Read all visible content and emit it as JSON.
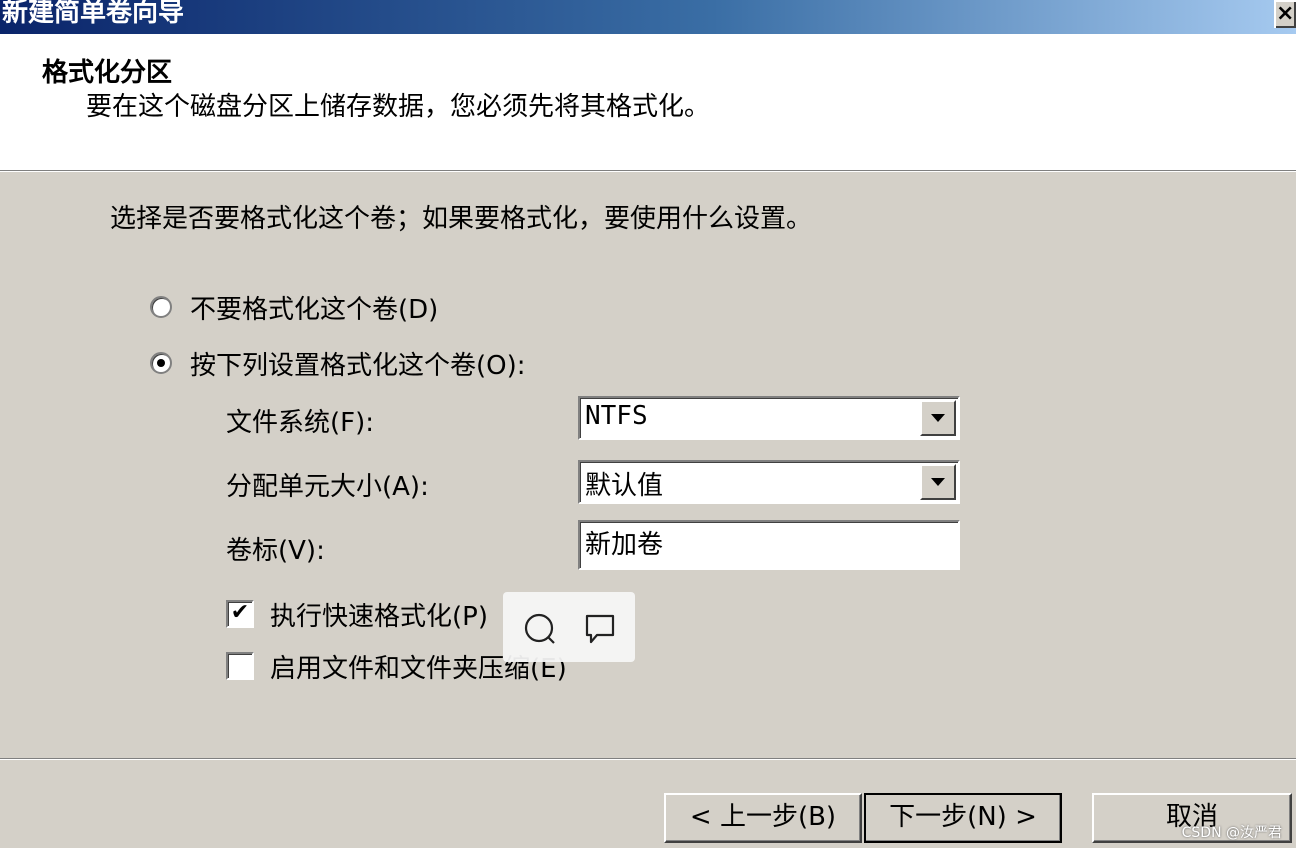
{
  "window": {
    "title": "新建简单卷向导",
    "close_glyph": "×"
  },
  "header": {
    "title": "格式化分区",
    "description": "要在这个磁盘分区上储存数据，您必须先将其格式化。"
  },
  "body": {
    "instruction": "选择是否要格式化这个卷；如果要格式化，要使用什么设置。",
    "radio_no_format": {
      "label": "不要格式化这个卷(D)",
      "checked": false
    },
    "radio_format": {
      "label": "按下列设置格式化这个卷(O):",
      "checked": true
    },
    "filesystem": {
      "label": "文件系统(F):",
      "value": "NTFS"
    },
    "alloc_unit": {
      "label": "分配单元大小(A):",
      "value": "默认值"
    },
    "volume_label": {
      "label": "卷标(V):",
      "value": "新加卷"
    },
    "quick_format": {
      "label": "执行快速格式化(P)",
      "checked": true,
      "check_glyph": "✔"
    },
    "compression": {
      "label": "启用文件和文件夹压缩(E)",
      "checked": false
    }
  },
  "overlay": {
    "icons": [
      "search-icon",
      "comment-icon"
    ]
  },
  "footer": {
    "back_label": "< 上一步(B)",
    "next_label": "下一步(N) >",
    "cancel_label": "取消"
  },
  "watermark": "CSDN @汝严君"
}
